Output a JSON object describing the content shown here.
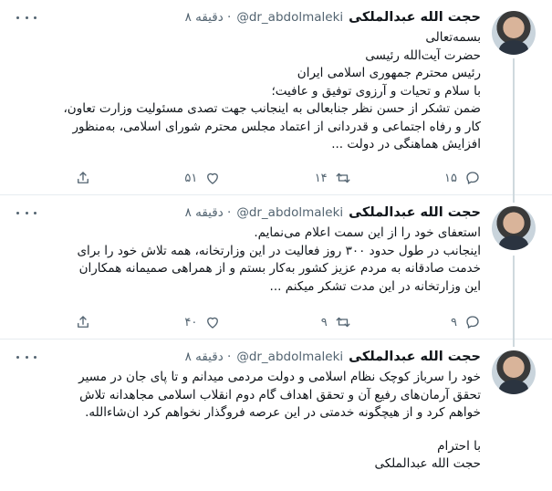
{
  "tweets": [
    {
      "author": "حجت الله عبدالملکی",
      "handle": "@dr_abdolmaleki",
      "time": "۸ دقیقه ·",
      "lines": [
        "بسمه‌تعالی",
        "حضرت آیت‌الله رئیسی",
        "رئیس محترم جمهوری اسلامی ایران",
        "با سلام و تحیات و آرزوی توفیق و عافیت؛",
        "ضمن تشکر از حسن نظر جنابعالی به اینجانب جهت تصدی مسئولیت وزارت تعاون،",
        "کار و رفاه اجتماعی و قدردانی از اعتماد مجلس محترم شورای اسلامی، به‌منظور",
        "افزایش هماهنگی در دولت ..."
      ],
      "replies": "۱۵",
      "retweets": "۱۴",
      "likes": "۵۱"
    },
    {
      "author": "حجت الله عبدالملکی",
      "handle": "@dr_abdolmaleki",
      "time": "۸ دقیقه ·",
      "lines": [
        "استعفای خود را از این سمت اعلام می‌نمایم.",
        "اینجانب در طول حدود ۳۰۰ روز فعالیت در این وزارتخانه، همه تلاش خود را برای",
        "خدمت صادقانه به مردم عزیز کشور به‌کار بستم و از همراهی صمیمانه همکاران",
        "این وزارتخانه در این مدت تشکر میکنم ..."
      ],
      "replies": "۹",
      "retweets": "۹",
      "likes": "۴۰"
    },
    {
      "author": "حجت الله عبدالملکی",
      "handle": "@dr_abdolmaleki",
      "time": "۸ دقیقه ·",
      "lines": [
        "خود را سرباز کوچک نظام اسلامی و دولت مردمی میدانم و تا پای جان در مسیر",
        "تحقق آرمان‌های رفیع آن و تحقق اهداف گام دوم انقلاب اسلامی مجاهدانه تلاش",
        "خواهم کرد و از هیچگونه خدمتی در این عرصه فروگذار نخواهم کرد ان‌شاءالله."
      ],
      "closing": [
        "با احترام",
        "حجت الله عبدالملکی"
      ]
    }
  ],
  "icons": {
    "reply": "reply-icon",
    "retweet": "retweet-icon",
    "like": "heart-icon",
    "share": "share-icon",
    "more": "more-icon"
  }
}
